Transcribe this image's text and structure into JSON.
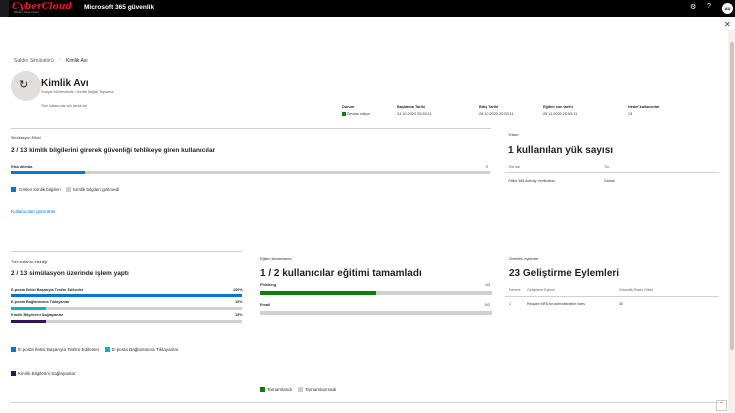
{
  "topbar": {
    "logo_main": "CyberCloud",
    "logo_tagline": "Bilişim Teknolojileri",
    "app_title": "Microsoft 365 güvenlik",
    "avatar_initials": "AU"
  },
  "breadcrumb": {
    "parent": "Saldırı Simülatörü",
    "current": "Kimlik Avı"
  },
  "header": {
    "title": "Kimlik Avı",
    "subtitle": "Sosyal Mühendislik • Kimlik Bilgisi Toplama",
    "description": "Tüm kullanıcılar için kimlik avı"
  },
  "meta": [
    {
      "label": "Durum",
      "value": "Devam ediyor"
    },
    {
      "label": "Başlatma Tarihi",
      "value": "24.10.2020 20:53:11"
    },
    {
      "label": "Bitiş Tarihi",
      "value": "28.10.2020 20:53:11"
    },
    {
      "label": "Eğitim son tarihi",
      "value": "25.11.2020 20:53:11"
    },
    {
      "label": "Hedef kullanıcılar",
      "value": "13"
    }
  ],
  "sim_effect": {
    "label": "Simülasyon Etkisi",
    "title": "2 / 13 kimlik bilgilerini girerek güvenliği tehlikeye giren kullanıcılar",
    "risk_label": "Risk altında",
    "risk_value": "2",
    "risk_fraction": 0.154,
    "legend": [
      "Girilen kimlik bilgileri",
      "Kimlik bilgileri girilmedi"
    ],
    "link": "Kullanıcıları görüntüle"
  },
  "payloads": {
    "label": "Yükler",
    "title": "1 kullanılan yük sayısı",
    "col_name": "Yük adı",
    "col_type": "Tür",
    "rows": [
      {
        "name": "Office 365 Activity Verification",
        "type": "Global"
      }
    ]
  },
  "user_activity": {
    "label": "Tüm kullanıcı etkinliği",
    "title": "2 / 13 simülasyon üzerinde işlem yaptı",
    "bars": [
      {
        "label": "E-posta İletisi Başarıyla Teslim Edilenler",
        "value": "100%",
        "fraction": 1.0,
        "color": "#0078d4"
      },
      {
        "label": "E-posta Bağlantısına Tıklayanlar",
        "value": "15%",
        "fraction": 0.15,
        "color": "#00b7c3"
      },
      {
        "label": "Kimlik Bilgilerini Sağlayanlar",
        "value": "15%",
        "fraction": 0.15,
        "color": "#32145a"
      }
    ],
    "legend": [
      "E-posta İletisi Başarıyla Teslim Edilenler",
      "E-posta Bağlantısına Tıklayanlar",
      "Kimlik Bilgilerini Sağlayanlar"
    ]
  },
  "training": {
    "label": "Eğitim tamamlama",
    "title": "1 / 2 kullanıcılar eğitimi tamamladı",
    "bars": [
      {
        "label": "Phishing",
        "value": "1/2",
        "fraction": 0.5,
        "color": "#107c10"
      },
      {
        "label": "Email",
        "value": "0/2",
        "fraction": 0,
        "color": "#107c10"
      }
    ],
    "legend": [
      "Tamamlandı",
      "Tamamlanmadı"
    ]
  },
  "recommended": {
    "label": "Önerilen eylemler",
    "title": "23 Geliştirme Eylemleri",
    "cols": [
      "Derece",
      "Geliştirme Eylemi",
      "Güvenlik Puanı Etkisi"
    ],
    "rows": [
      {
        "rank": "1",
        "action": "Require MFA for administrative roles",
        "score": "30"
      }
    ]
  },
  "colors": {
    "primary": "#0078d4",
    "success": "#107c10",
    "gray": "#d2d0ce"
  }
}
